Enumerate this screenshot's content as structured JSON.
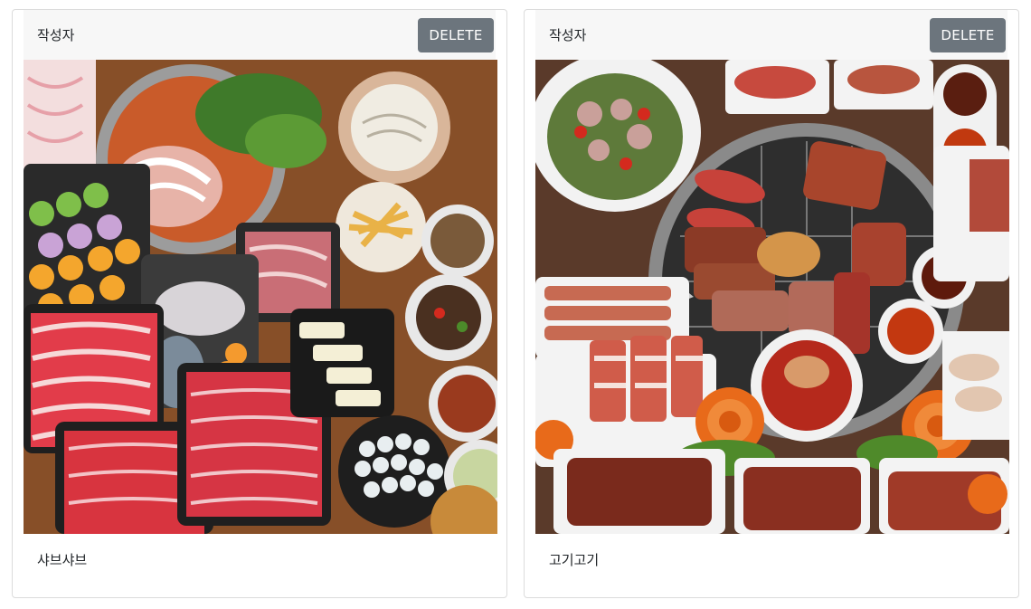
{
  "cards": [
    {
      "author": "작성자",
      "delete_label": "DELETE",
      "title": "샤브샤브",
      "image_alt": "shabu-shabu hot pot spread"
    },
    {
      "author": "작성자",
      "delete_label": "DELETE",
      "title": "고기고기",
      "image_alt": "korean bbq grill spread"
    }
  ],
  "colors": {
    "card_header_bg": "#f7f7f7",
    "delete_button_bg": "#6c757d",
    "card_border": "#dcdcdc"
  }
}
